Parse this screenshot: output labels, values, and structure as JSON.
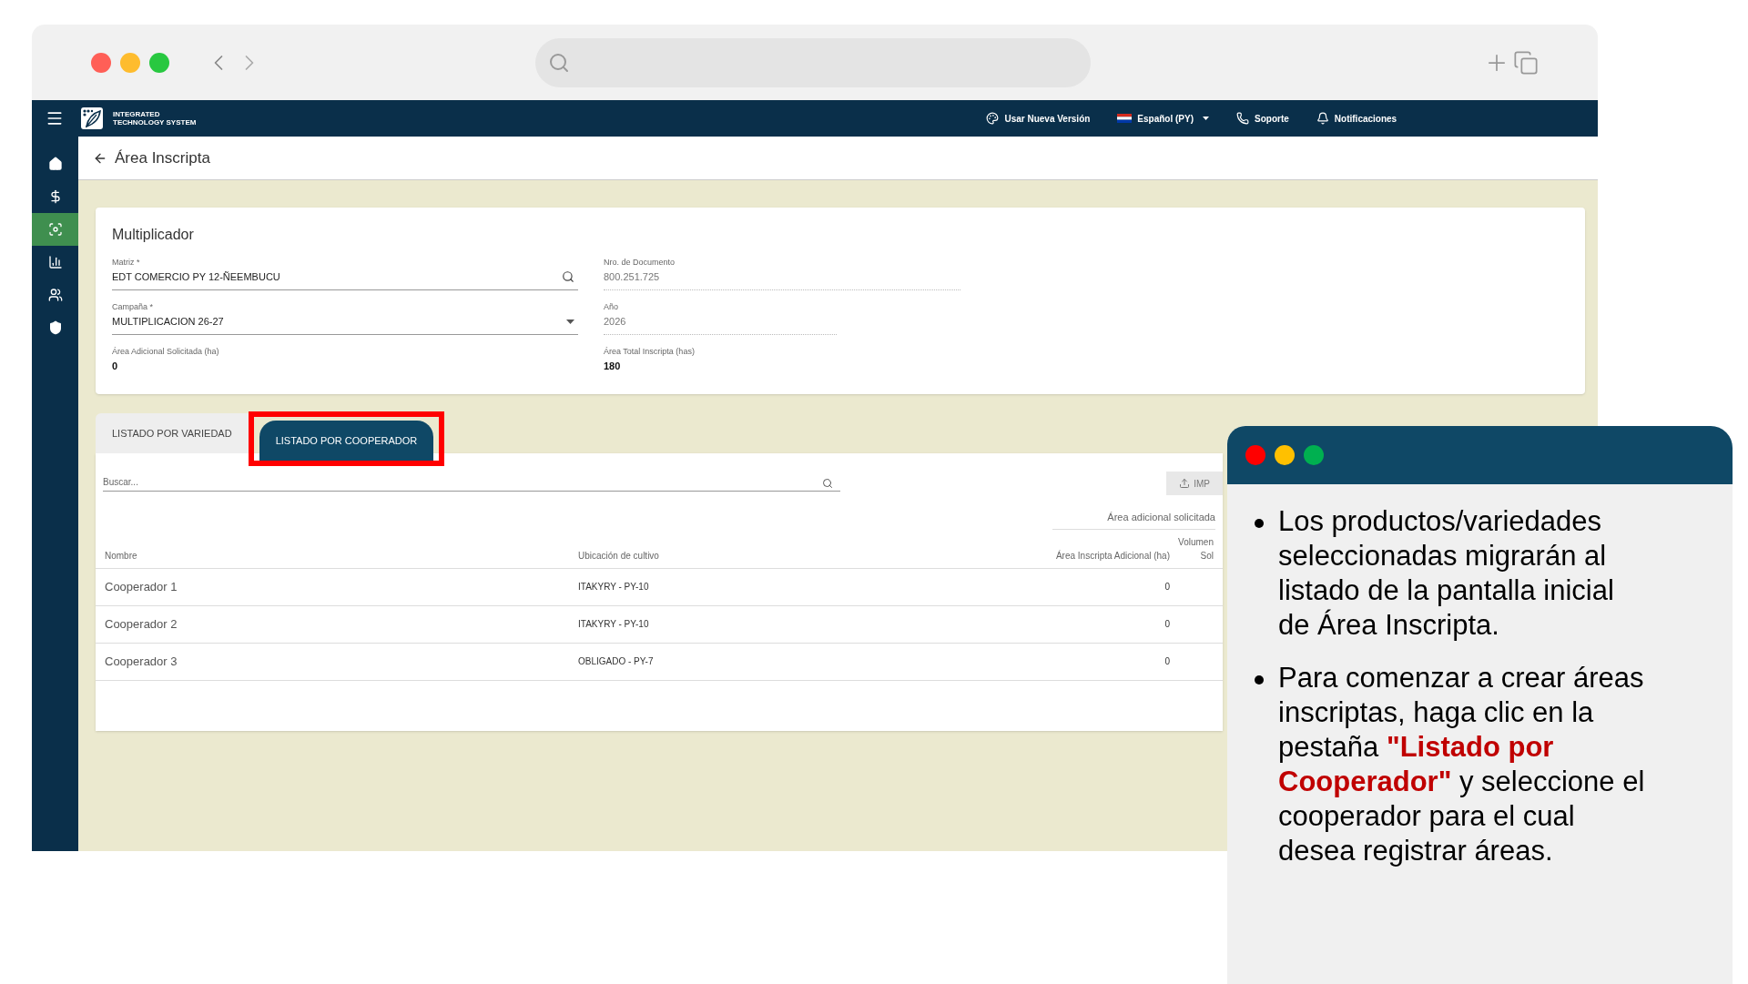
{
  "app": {
    "brand": [
      "INTEGRATED",
      "TECHNOLOGY SYSTEM"
    ],
    "header_items": [
      {
        "label": "Usar Nueva Versión",
        "kind": "palette"
      },
      {
        "label": "Español (PY)",
        "kind": "language"
      },
      {
        "label": "Soporte",
        "kind": "phone"
      },
      {
        "label": "Notificaciones",
        "kind": "bell"
      }
    ],
    "sidebar": {
      "items": [
        {
          "selected": false
        },
        {
          "selected": false
        },
        {
          "selected": true
        },
        {
          "selected": false
        },
        {
          "selected": false
        },
        {
          "selected": false
        }
      ]
    },
    "page_title": "Área Inscripta",
    "card": {
      "title": "Multiplicador",
      "fields": [
        {
          "kind": "search",
          "label": "Matriz *",
          "value": "EDT COMERCIO PY 12-ÑEEMBUCU"
        },
        {
          "kind": "readonly",
          "label": "Nro. de Documento",
          "value": "800.251.725"
        },
        {
          "kind": "select",
          "label": "Campaña *",
          "value": "MULTIPLICACION 26-27"
        },
        {
          "kind": "readonly",
          "label": "Año",
          "value": "2026"
        },
        {
          "kind": "display",
          "label": "Área Adicional Solicitada (ha)",
          "value": "0"
        },
        {
          "kind": "display",
          "label": "Área Total Inscripta (has)",
          "value": "180"
        }
      ]
    },
    "tabs": [
      {
        "label": "LISTADO POR VARIEDAD",
        "selected": false,
        "highlighted": false
      },
      {
        "label": "LISTADO POR COOPERADOR",
        "selected": true,
        "highlighted": true
      }
    ],
    "search": {
      "placeholder": "Buscar..."
    },
    "import_button": {
      "label": "IMP",
      "disabled": true
    },
    "table": {
      "group_header": "Área adicional solicitada",
      "columns": [
        "Nombre",
        "Ubicación de cultivo",
        "Área Inscripta Adicional (ha)",
        "Volumen",
        "Sol"
      ],
      "rows": [
        {
          "name": "Cooperador 1",
          "location": "ITAKYRY - PY-10",
          "area": "0"
        },
        {
          "name": "Cooperador 2",
          "location": "ITAKYRY - PY-10",
          "area": "0"
        },
        {
          "name": "Cooperador 3",
          "location": "OBLIGADO - PY-7",
          "area": "0"
        }
      ]
    }
  },
  "callout": {
    "bullets": [
      "Los productos/variedades seleccionadas migrarán al listado de la pantalla inicial de Área Inscripta.",
      "Para comenzar a crear áreas inscriptas, haga clic en la pestaña **\"Listado por Cooperador\"** y seleccione el cooperador para el cual desea registrar áreas."
    ]
  }
}
